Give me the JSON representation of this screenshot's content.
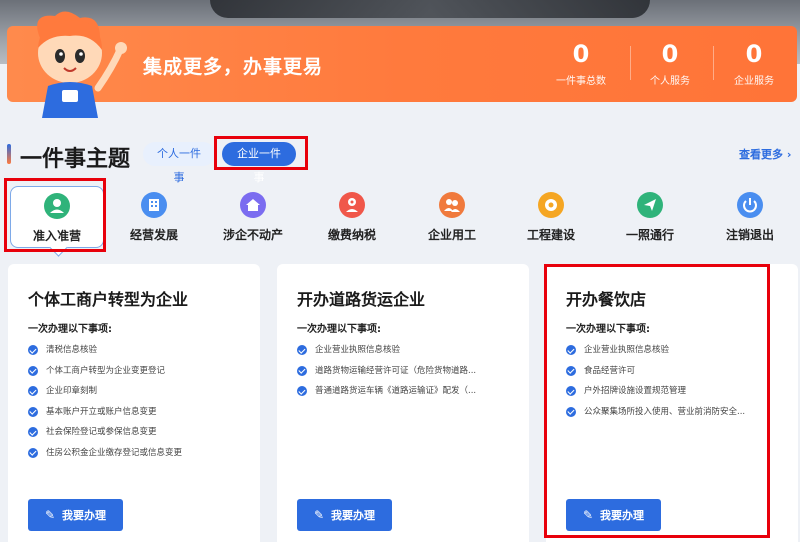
{
  "banner": {
    "slogan": "集成更多，办事更易",
    "stats": [
      {
        "value": "0",
        "label": "一件事总数"
      },
      {
        "value": "0",
        "label": "个人服务"
      },
      {
        "value": "0",
        "label": "企业服务"
      }
    ]
  },
  "section": {
    "title": "一件事主题",
    "tabs": [
      {
        "label": "个人一件事",
        "active": false
      },
      {
        "label": "企业一件事",
        "active": true
      }
    ],
    "more_label": "查看更多 ›"
  },
  "categories": [
    {
      "label": "准入准营",
      "icon": "user-badge-icon",
      "color": "#2fb37a",
      "selected": true
    },
    {
      "label": "经营发展",
      "icon": "building-icon",
      "color": "#4a8ef0",
      "selected": false
    },
    {
      "label": "涉企不动产",
      "icon": "house-icon",
      "color": "#7b6cf0",
      "selected": false
    },
    {
      "label": "缴费纳税",
      "icon": "tax-person-icon",
      "color": "#f0574a",
      "selected": false
    },
    {
      "label": "企业用工",
      "icon": "workers-icon",
      "color": "#f07a3d",
      "selected": false
    },
    {
      "label": "工程建设",
      "icon": "gear-icon",
      "color": "#f5a623",
      "selected": false
    },
    {
      "label": "一照通行",
      "icon": "send-icon",
      "color": "#2fb37a",
      "selected": false
    },
    {
      "label": "注销退出",
      "icon": "power-icon",
      "color": "#4a8ef0",
      "selected": false
    }
  ],
  "cards": [
    {
      "title": "个体工商户转型为企业",
      "subtitle": "一次办理以下事项:",
      "items": [
        "清税信息核验",
        "个体工商户转型为企业变更登记",
        "企业印章刻制",
        "基本账户开立或账户信息变更",
        "社会保险登记或参保信息变更",
        "住房公积金企业缴存登记或信息变更"
      ],
      "button": "我要办理"
    },
    {
      "title": "开办道路货运企业",
      "subtitle": "一次办理以下事项:",
      "items": [
        "企业营业执照信息核验",
        "道路货物运输经营许可证（危险货物道路...",
        "普通道路货运车辆《道路运输证》配发（..."
      ],
      "button": "我要办理"
    },
    {
      "title": "开办餐饮店",
      "subtitle": "一次办理以下事项:",
      "items": [
        "企业营业执照信息核验",
        "食品经营许可",
        "户外招牌设施设置规范管理",
        "公众聚集场所投入使用、营业前消防安全..."
      ],
      "button": "我要办理"
    }
  ],
  "colors": {
    "accent": "#2d6cdf",
    "banner": "#ff7a3d",
    "highlight": "#e8000b"
  }
}
